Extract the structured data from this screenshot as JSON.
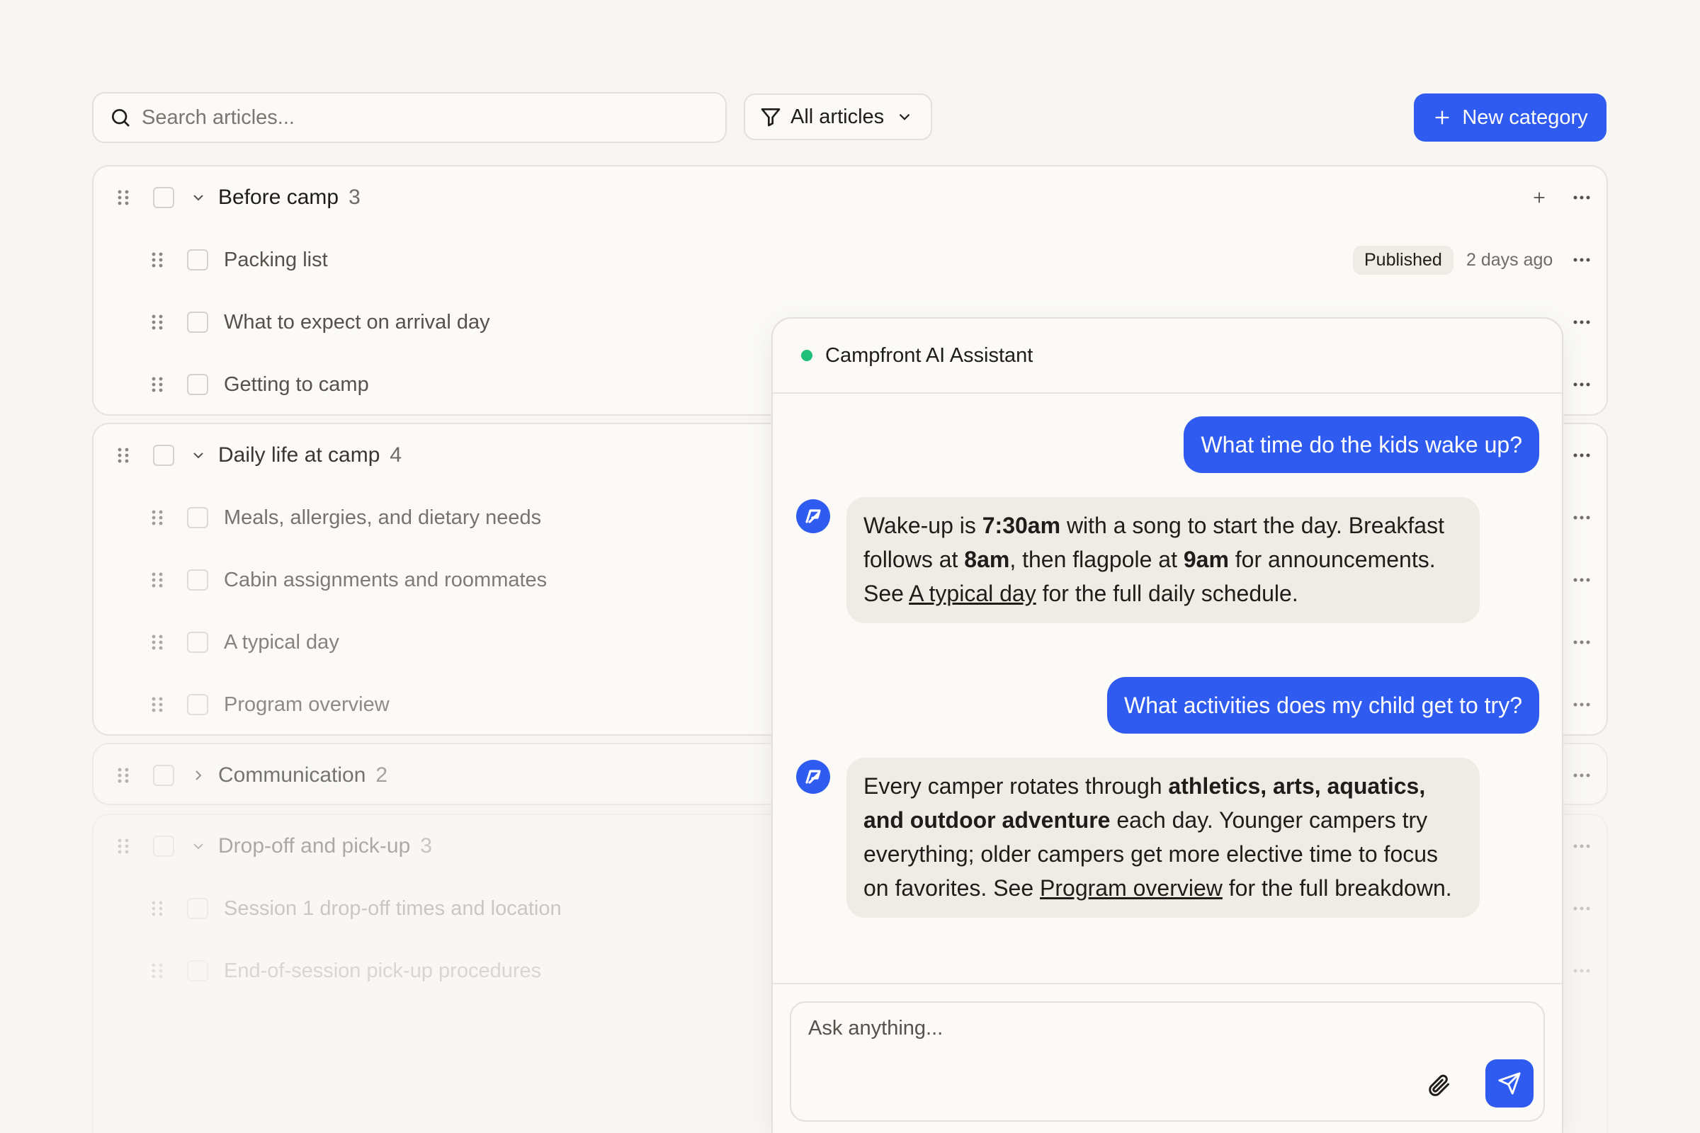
{
  "toolbar": {
    "search_placeholder": "Search articles...",
    "filter_label": "All articles",
    "new_category_label": "New category"
  },
  "groups": [
    {
      "title": "Before camp",
      "count": "3",
      "items": [
        {
          "title": "Packing list",
          "status": "Published",
          "date": "2 days ago"
        },
        {
          "title": "What to expect on arrival day"
        },
        {
          "title": "Getting to camp"
        }
      ]
    },
    {
      "title": "Daily life at camp",
      "count": "4",
      "items": [
        {
          "title": "Meals, allergies, and dietary needs"
        },
        {
          "title": "Cabin assignments and roommates"
        },
        {
          "title": "A typical day"
        },
        {
          "title": "Program overview"
        }
      ]
    },
    {
      "title": "Communication",
      "count": "2",
      "items": []
    },
    {
      "title": "Drop-off and pick-up",
      "count": "3",
      "items": [
        {
          "title": "Session 1 drop-off times and location"
        },
        {
          "title": "End-of-session pick-up procedures"
        }
      ]
    }
  ],
  "chat": {
    "title": "Campfront AI Assistant",
    "messages": [
      {
        "role": "user",
        "text": "What time do the kids wake up?"
      },
      {
        "role": "assistant",
        "parts": [
          "Wake-up is ",
          "7:30am",
          " with a song to start the day. Breakfast follows at ",
          "8am",
          ", then flagpole at ",
          "9am",
          " for announcements. See ",
          "A typical day",
          " for the full daily schedule."
        ]
      },
      {
        "role": "user",
        "text": "What activities does my child get to try?"
      },
      {
        "role": "assistant",
        "parts": [
          "Every camper rotates through ",
          "athletics, arts, aquatics, and outdoor adventure",
          " each day. Younger campers try everything; older campers get more elective time to focus on favorites. See ",
          "Program overview",
          " for the full breakdown."
        ]
      }
    ],
    "input_placeholder": "Ask anything..."
  },
  "colors": {
    "accent": "#2f5bf0",
    "online": "#1fbf7a"
  }
}
